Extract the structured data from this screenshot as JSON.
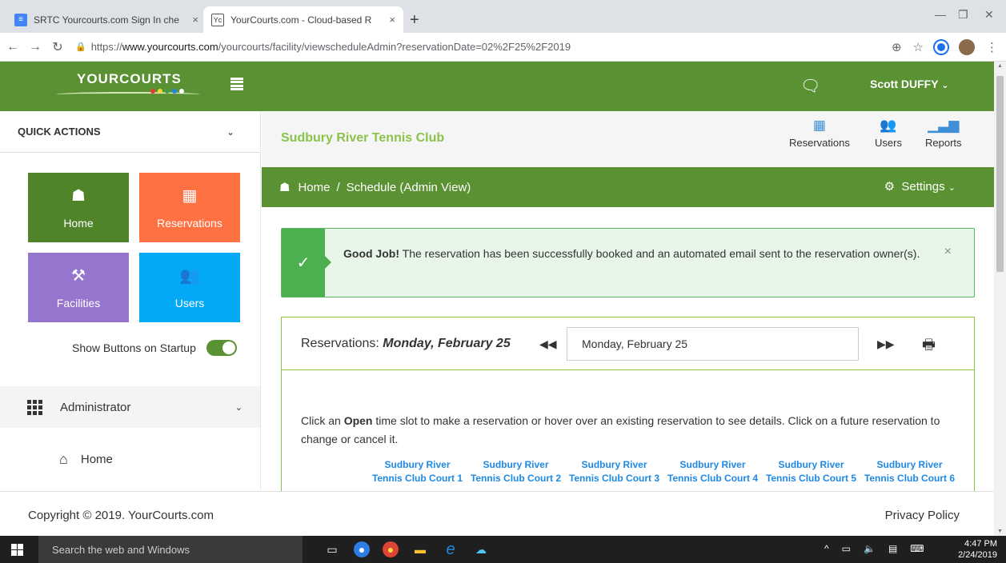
{
  "browser": {
    "tabs": [
      {
        "title": "SRTC Yourcourts.com Sign In che",
        "close": "×"
      },
      {
        "title": "YourCourts.com - Cloud-based R",
        "close": "×"
      }
    ],
    "new_tab": "+",
    "url_prefix": "https://",
    "url_host": "www.yourcourts.com",
    "url_path": "/yourcourts/facility/viewscheduleAdmin?reservationDate=02%2F25%2F2019"
  },
  "header": {
    "logo": "YOURCOURTS",
    "user_name": "Scott DUFFY"
  },
  "sidebar": {
    "quick_actions_title": "QUICK ACTIONS",
    "tiles": {
      "home": "Home",
      "reservations": "Reservations",
      "facilities": "Facilities",
      "users": "Users"
    },
    "toggle_label": "Show Buttons on Startup",
    "admin_label": "Administrator",
    "home_link": "Home"
  },
  "topnav": {
    "club_name": "Sudbury River Tennis Club",
    "items": {
      "reservations": "Reservations",
      "users": "Users",
      "reports": "Reports"
    }
  },
  "breadcrumb": {
    "home": "Home",
    "separator": "/",
    "current": "Schedule (Admin View)",
    "settings": "Settings"
  },
  "alert": {
    "strong": "Good Job!",
    "message": " The reservation has been successfully booked and an automated email sent to the reservation owner(s).",
    "close": "×"
  },
  "schedule": {
    "title_prefix": "Reservations: ",
    "title_date": "Monday, February 25",
    "date_value": "Monday, February 25",
    "instr_pre": "Click an ",
    "instr_bold": "Open",
    "instr_post": " time slot to make a reservation or hover over an existing reservation to see details. Click on a future reservation to change or cancel it.",
    "courts": [
      "Sudbury River Tennis Club Court 1",
      "Sudbury River Tennis Club Court 2",
      "Sudbury River Tennis Club Court 3",
      "Sudbury River Tennis Club Court 4",
      "Sudbury River Tennis Club Court 5",
      "Sudbury River Tennis Club Court 6"
    ]
  },
  "footer": {
    "copyright": "Copyright © 2019. YourCourts.com",
    "privacy": "Privacy Policy"
  },
  "taskbar": {
    "search_placeholder": "Search the web and Windows",
    "time": "4:47 PM",
    "date": "2/24/2019"
  }
}
